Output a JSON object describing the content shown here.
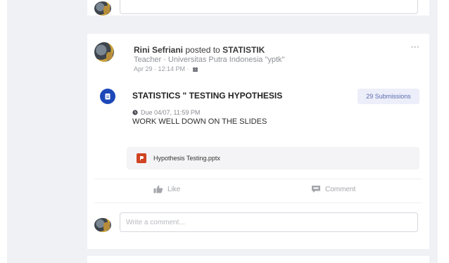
{
  "top_card": {
    "comment_placeholder": "Write a comment..."
  },
  "post": {
    "poster_name": "Rini Sefriani",
    "posted_to_text": "posted to",
    "group_name": "STATISTIK",
    "role_line": "Teacher · Universitas Putra Indonesia \"yptk\"",
    "timestamp": "Apr 29 · 12:14 PM ·",
    "assignment": {
      "title": "STATISTICS \" TESTING HYPOTHESIS",
      "submissions_label": "29 Submissions",
      "due": "Due 04/07, 11:59 PM",
      "description": "WORK WELL DOWN ON THE SLIDES"
    },
    "attachment": {
      "file_name": "Hypothesis Testing.pptx",
      "icon": "powerpoint-icon"
    },
    "actions": {
      "like_label": "Like",
      "comment_label": "Comment"
    },
    "comment_placeholder": "Write a comment..."
  },
  "colors": {
    "page_bg": "#f0f1f5",
    "assignment_icon": "#1c48b8",
    "submissions_bg": "#eceef9",
    "ppt_icon": "#d04423"
  }
}
